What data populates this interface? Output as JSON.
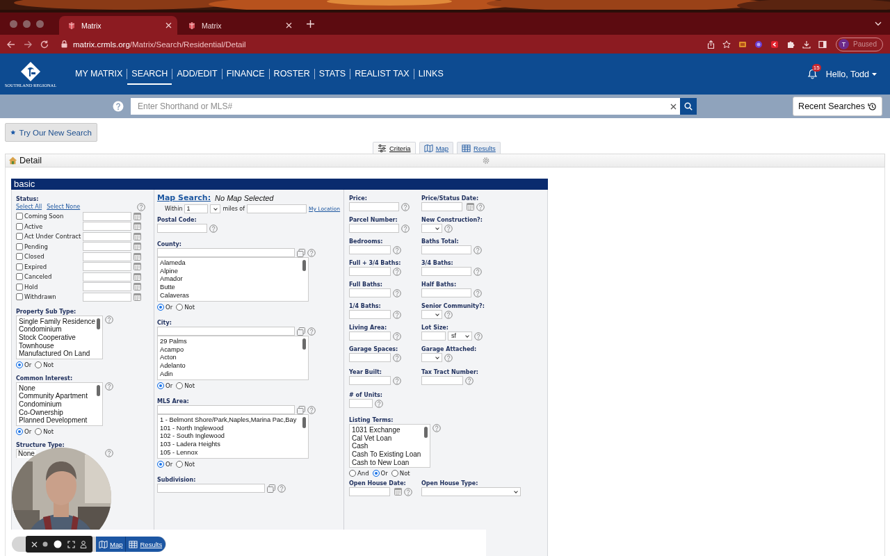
{
  "browser": {
    "tabs": [
      {
        "title": "Matrix",
        "selected": true
      },
      {
        "title": "Matrix",
        "selected": false
      }
    ],
    "address": {
      "host": "matrix.crmls.org",
      "path": "/Matrix/Search/Residential/Detail"
    },
    "profile": {
      "initial": "T",
      "status": "Paused"
    }
  },
  "header": {
    "logo_text": "SOUTHLAND REGIONAL",
    "nav": [
      {
        "label": "MY MATRIX",
        "selected": false
      },
      {
        "label": "SEARCH",
        "selected": true
      },
      {
        "label": "ADD/EDIT",
        "selected": false
      },
      {
        "label": "FINANCE",
        "selected": false
      },
      {
        "label": "ROSTER",
        "selected": false
      },
      {
        "label": "STATS",
        "selected": false
      },
      {
        "label": "REALIST TAX",
        "selected": false
      },
      {
        "label": "LINKS",
        "selected": false
      }
    ],
    "notification_count": "15",
    "greeting": "Hello, Todd"
  },
  "quick_search": {
    "placeholder": "Enter Shorthand or MLS#",
    "recent": "Recent Searches"
  },
  "promo_button": "Try Our New Search",
  "view_tabs": [
    {
      "label": "Criteria",
      "kind": "criteria",
      "selected": true
    },
    {
      "label": "Map",
      "kind": "map",
      "selected": false
    },
    {
      "label": "Results",
      "kind": "results",
      "selected": false
    }
  ],
  "panel_title": "Detail",
  "section": "basic",
  "status": {
    "label": "Status:",
    "select_all": "Select All",
    "select_none": "Select None",
    "options": [
      {
        "label": "Coming Soon",
        "checked": false
      },
      {
        "label": "Active",
        "checked": false
      },
      {
        "label": "Act Under Contract",
        "checked": false
      },
      {
        "label": "Pending",
        "checked": false
      },
      {
        "label": "Closed",
        "checked": false
      },
      {
        "label": "Expired",
        "checked": false
      },
      {
        "label": "Canceled",
        "checked": false
      },
      {
        "label": "Hold",
        "checked": false
      },
      {
        "label": "Withdrawn",
        "checked": false
      }
    ]
  },
  "left_lists": [
    {
      "label": "Property Sub Type:",
      "items": [
        "Single Family Residence",
        "Condominium",
        "Stock Cooperative",
        "Townhouse",
        "Manufactured On Land"
      ],
      "match": [
        {
          "label": "Or",
          "selected": true
        },
        {
          "label": "Not",
          "selected": false
        }
      ]
    },
    {
      "label": "Common Interest:",
      "items": [
        "None",
        "Community Apartment",
        "Condominium",
        "Co-Ownership",
        "Planned Development"
      ],
      "match": [
        {
          "label": "Or",
          "selected": true
        },
        {
          "label": "Not",
          "selected": false
        }
      ]
    },
    {
      "label": "Structure Type:",
      "items": [
        "None"
      ]
    }
  ],
  "map_search": {
    "label": "Map Search:",
    "value": "No Map Selected",
    "within": "Within",
    "radius": "1",
    "miles_of": "miles of",
    "location_link": "My Location"
  },
  "postal_code": {
    "label": "Postal Code:"
  },
  "lookups": [
    {
      "label": "County:",
      "items": [
        "Alameda",
        "Alpine",
        "Amador",
        "Butte",
        "Calaveras"
      ],
      "match": [
        {
          "label": "Or",
          "selected": true
        },
        {
          "label": "Not",
          "selected": false
        }
      ]
    },
    {
      "label": "City:",
      "items": [
        "29 Palms",
        "Acampo",
        "Acton",
        "Adelanto",
        "Adin"
      ],
      "match": [
        {
          "label": "Or",
          "selected": true
        },
        {
          "label": "Not",
          "selected": false
        }
      ]
    },
    {
      "label": "MLS Area:",
      "items": [
        "1 - Belmont Shore/Park,Naples,Marina Pac,Bay",
        "101 - North Inglewood",
        "102 - South Inglewood",
        "103 - Ladera Heights",
        "105 - Lennox"
      ],
      "match": [
        {
          "label": "Or",
          "selected": true
        },
        {
          "label": "Not",
          "selected": false
        }
      ]
    }
  ],
  "subdivision": {
    "label": "Subdivision:"
  },
  "criteria_rows": [
    {
      "fields": [
        {
          "label": "Price:",
          "kind": "wide_text"
        },
        {
          "label": "Price/Status Date:",
          "kind": "date"
        }
      ]
    },
    {
      "fields": [
        {
          "label": "Parcel Number:",
          "kind": "wide_text"
        },
        {
          "label": "New Construction?:",
          "kind": "select"
        }
      ]
    },
    {
      "fields": [
        {
          "label": "Bedrooms:",
          "kind": "text"
        },
        {
          "label": "Baths Total:",
          "kind": "wide_text"
        }
      ]
    },
    {
      "fields": [
        {
          "label": "Full + 3/4 Baths:",
          "kind": "text"
        },
        {
          "label": "3/4 Baths:",
          "kind": "wide_text"
        }
      ]
    },
    {
      "fields": [
        {
          "label": "Full Baths:",
          "kind": "text"
        },
        {
          "label": "Half Baths:",
          "kind": "wide_text"
        }
      ]
    },
    {
      "fields": [
        {
          "label": "1/4 Baths:",
          "kind": "text"
        },
        {
          "label": "Senior Community?:",
          "kind": "select"
        }
      ]
    },
    {
      "fields": [
        {
          "label": "Living Area:",
          "kind": "text"
        },
        {
          "label": "Lot Size:",
          "kind": "lot",
          "unit": "sf"
        }
      ]
    },
    {
      "fields": [
        {
          "label": "Garage Spaces:",
          "kind": "text"
        },
        {
          "label": "Garage Attached:",
          "kind": "select"
        }
      ]
    },
    {
      "fields": [
        {
          "label": "Year Built:",
          "kind": "text"
        },
        {
          "label": "Tax Tract Number:",
          "kind": "text"
        }
      ]
    },
    {
      "fields": [
        {
          "label": "# of Units:",
          "kind": "short"
        }
      ]
    }
  ],
  "listing_terms": {
    "label": "Listing Terms:",
    "items": [
      "1031 Exchange",
      "Cal Vet Loan",
      "Cash",
      "Cash To Existing Loan",
      "Cash to New Loan"
    ],
    "match": [
      {
        "label": "And",
        "selected": false
      },
      {
        "label": "Or",
        "selected": true
      },
      {
        "label": "Not",
        "selected": false
      }
    ]
  },
  "open_house": [
    {
      "label": "Open House Date:",
      "kind": "date"
    },
    {
      "label": "Open House Type:",
      "kind": "wide_select"
    }
  ],
  "floating_tabs": [
    {
      "label": "Map",
      "kind": "map"
    },
    {
      "label": "Results",
      "kind": "results"
    }
  ]
}
